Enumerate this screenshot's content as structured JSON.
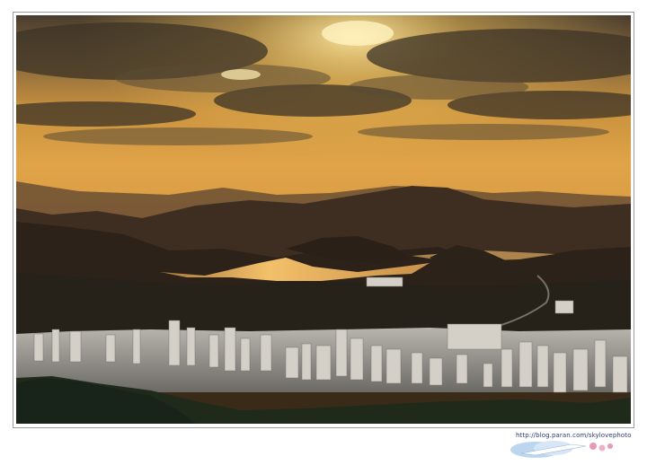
{
  "photo": {
    "subject": "city-skyline-sunset-landscape-photo"
  },
  "watermark": {
    "url": "http://blog.paran.com/skylovephoto",
    "icon": "cloud-logo-icon"
  },
  "colors": {
    "sky_top": "#4a3d2e",
    "sky_glow": "#f2c35a",
    "sky_horizon": "#d89a3e",
    "water": "#f0b860",
    "frame": "#9a9a9a"
  }
}
